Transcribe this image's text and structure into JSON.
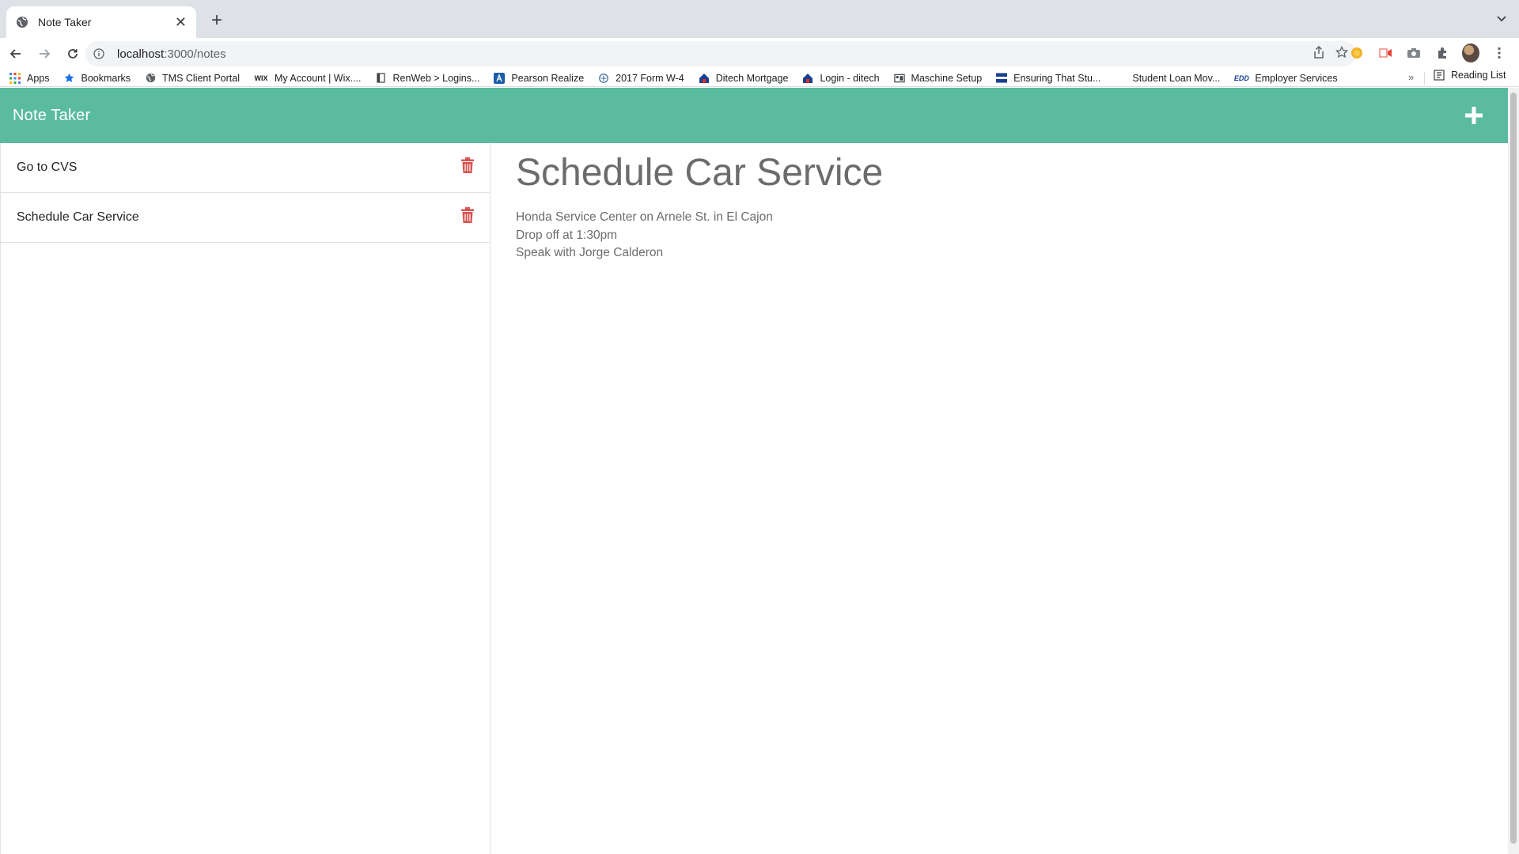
{
  "browser": {
    "tab_title": "Note Taker",
    "url_host": "localhost",
    "url_path": ":3000/notes",
    "bookmarks": [
      {
        "label": "Apps",
        "icon": "apps-grid-icon"
      },
      {
        "label": "Bookmarks",
        "icon": "star-icon"
      },
      {
        "label": "TMS Client Portal",
        "icon": "globe-icon"
      },
      {
        "label": "My Account | Wix....",
        "icon": "wix-icon"
      },
      {
        "label": "RenWeb > Logins...",
        "icon": "page-icon"
      },
      {
        "label": "Pearson Realize",
        "icon": "pearson-icon"
      },
      {
        "label": "2017 Form W-4",
        "icon": "irs-icon"
      },
      {
        "label": "Ditech Mortgage",
        "icon": "house-icon"
      },
      {
        "label": "Login - ditech",
        "icon": "house-icon"
      },
      {
        "label": "Maschine Setup",
        "icon": "maschine-icon"
      },
      {
        "label": "Ensuring That Stu...",
        "icon": "flag-icon"
      },
      {
        "label": "Student Loan Mov...",
        "icon": "blank-icon"
      },
      {
        "label": "Employer Services",
        "icon": "edd-icon"
      }
    ],
    "reading_list": "Reading List"
  },
  "app": {
    "brand": "Note Taker",
    "notes": [
      {
        "title": "Go to CVS"
      },
      {
        "title": "Schedule Car Service"
      }
    ],
    "active_note": {
      "title": "Schedule Car Service",
      "body_lines": [
        "Honda Service Center on Arnele St. in El Cajon",
        "Drop off at 1:30pm",
        "Speak with Jorge Calderon"
      ]
    }
  },
  "colors": {
    "navbar": "#5bbb9e",
    "delete_icon": "#d9534f"
  }
}
